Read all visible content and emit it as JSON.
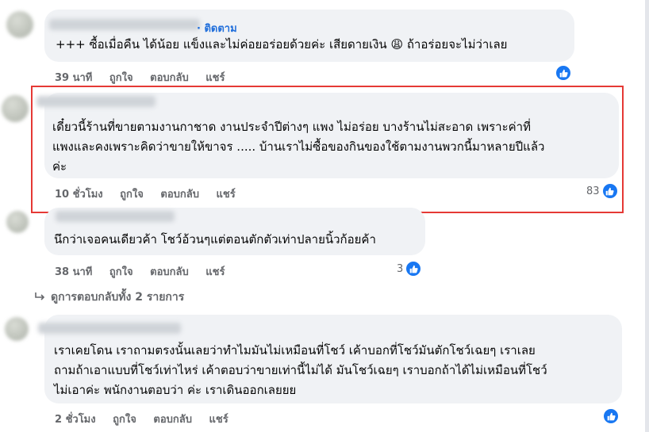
{
  "comments": [
    {
      "follow_label": "· ติดตาม",
      "lines": [
        "+++ ซื้อเมื่อคืน ได้น้อย แข็งและไม่ค่อยอร่อยด้วยค่ะ เสียดายเงิน 😩 ถ้าอร่อยจะไม่ว่าเลย"
      ],
      "time": "39 นาที",
      "like_label": "ถูกใจ",
      "reply_label": "ตอบกลับ",
      "share_label": "แชร์",
      "reaction_count": ""
    },
    {
      "lines": [
        "เดี๋ยวนี้ร้านที่ขายตามงานกาชาด งานประจำปีต่างๆ แพง ไม่อร่อย บางร้านไม่สะอาด เพราะค่าที่",
        "แพงและคงเพราะคิดว่าขายให้ขาจร ..... บ้านเราไม่ซื้อของกินของใช้ตามงานพวกนี้มาหลายปีแล้ว",
        "ค่ะ"
      ],
      "time": "10 ชั่วโมง",
      "like_label": "ถูกใจ",
      "reply_label": "ตอบกลับ",
      "share_label": "แชร์",
      "reaction_count": "83"
    },
    {
      "lines": [
        "นึกว่าเจอคนเดียวค้า โชว์อ้วนๆแต่ตอนตักตัวเท่าปลายนิ้วก้อยค้า"
      ],
      "time": "38 นาที",
      "like_label": "ถูกใจ",
      "reply_label": "ตอบกลับ",
      "share_label": "แชร์",
      "reaction_count": "3"
    },
    {
      "lines": [
        "เราเคยโดน เราถามตรงนั้นเลยว่าทำไมมันไม่เหมือนที่โชว์ เค้าบอกที่โชว์มันตักโชว์เฉยๆ เราเลย",
        "ถามถ้าเอาแบบที่โชว์เท่าไหร่ เค้าตอบว่าขายเท่านี้ไม่ได้ มันโชว์เฉยๆ เราบอกถ้าได้ไม่เหมือนที่โชว์",
        "ไม่เอาค่ะ พนักงานตอบว่า ค่ะ เราเดินออกเลยยย"
      ],
      "time": "2 ชั่วโมง",
      "like_label": "ถูกใจ",
      "reply_label": "ตอบกลับ",
      "share_label": "แชร์",
      "reaction_count": ""
    }
  ],
  "view_replies": "ดูการตอบกลับทั้ง 2 รายการ",
  "colors": {
    "accent": "#1877f2",
    "highlight": "#e53935",
    "bubble": "#f0f2f5",
    "meta": "#65676b"
  },
  "icons": {
    "reaction": "like-thumb-icon",
    "reply_arrow": "reply-arrow-icon"
  }
}
